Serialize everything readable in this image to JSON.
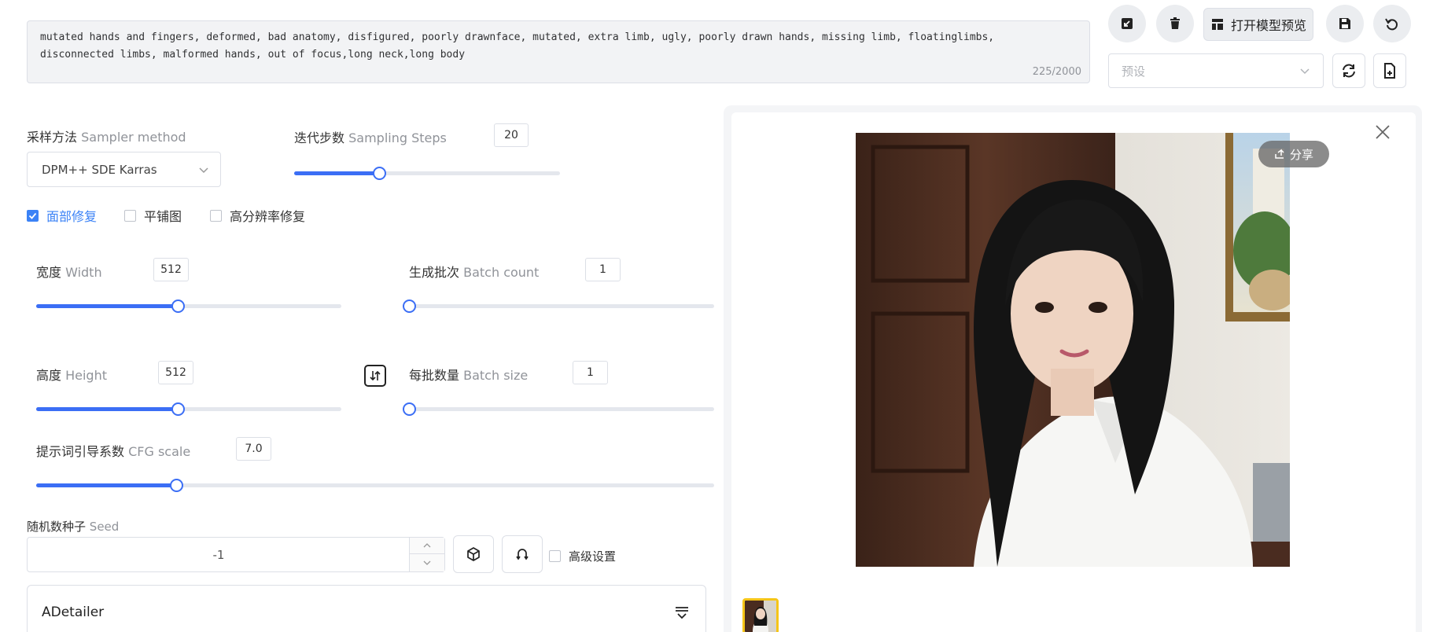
{
  "negative_prompt": {
    "text": "mutated hands and fingers, deformed, bad anatomy, disfigured, poorly drawnface, mutated, extra limb, ugly, poorly drawn hands, missing limb, floatinglimbs,\ndisconnected limbs, malformed hands, out of focus,long neck,long body",
    "count": "225/2000"
  },
  "toolbar": {
    "open_preview_label": "打开模型预览",
    "icons": [
      "image-import-icon",
      "trash-icon",
      "layout-icon",
      "save-icon",
      "undo-icon",
      "refresh-icon",
      "new-file-icon"
    ],
    "preset_placeholder": "预设"
  },
  "sampler": {
    "label_cn": "采样方法",
    "label_en": "Sampler method",
    "value": "DPM++ SDE Karras"
  },
  "steps": {
    "label_cn": "迭代步数",
    "label_en": "Sampling Steps",
    "value": "20",
    "fraction": 0.32
  },
  "checks": {
    "face_restore": {
      "label": "面部修复",
      "checked": true
    },
    "tiling": {
      "label": "平铺图",
      "checked": false
    },
    "hires": {
      "label": "高分辨率修复",
      "checked": false
    }
  },
  "width": {
    "label_cn": "宽度",
    "label_en": "Width",
    "value": "512",
    "fraction": 0.465
  },
  "height": {
    "label_cn": "高度",
    "label_en": "Height",
    "value": "512",
    "fraction": 0.465
  },
  "batch_count": {
    "label_cn": "生成批次",
    "label_en": "Batch count",
    "value": "1",
    "fraction": 0.0
  },
  "batch_size": {
    "label_cn": "每批数量",
    "label_en": "Batch size",
    "value": "1",
    "fraction": 0.0
  },
  "cfg": {
    "label_cn": "提示词引导系数",
    "label_en": "CFG scale",
    "value": "7.0",
    "fraction": 0.207
  },
  "seed": {
    "label_cn": "随机数种子",
    "label_en": "Seed",
    "value": "-1",
    "advanced_label": "高级设置"
  },
  "adetailer": {
    "label": "ADetailer"
  },
  "result": {
    "share_label": "分享"
  },
  "colors": {
    "accent": "#3b6ef5",
    "checked": "#3b82f6",
    "thumb_border": "#f5c518"
  }
}
